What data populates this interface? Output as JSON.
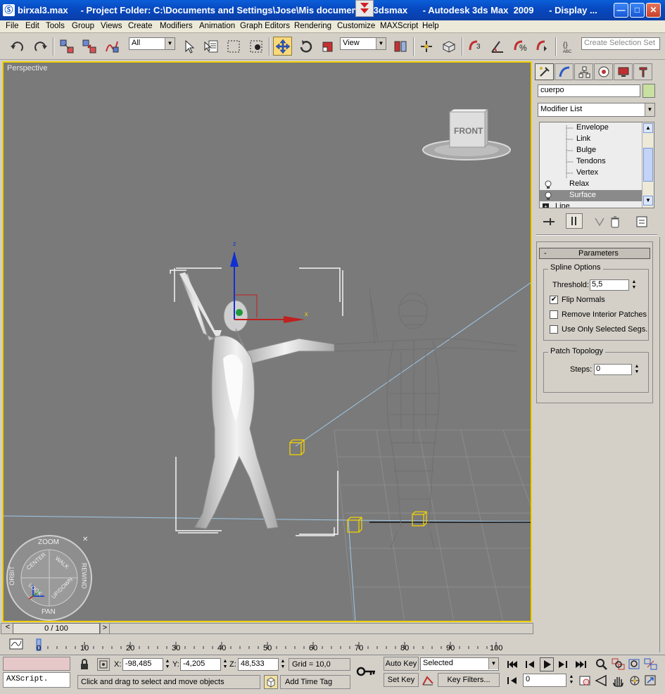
{
  "window": {
    "title": "birxal3.max     - Project Folder: C:\\Documents and Settings\\Jose\\Mis documentos\\3dsmax      - Autodesk 3ds Max  2009      - Display ...",
    "minimize_icon": "minimize-icon",
    "maximize_icon": "maximize-icon",
    "close_icon": "close-icon"
  },
  "menu": [
    "File",
    "Edit",
    "Tools",
    "Group",
    "Views",
    "Create",
    "Modifiers",
    "Animation",
    "Graph Editors",
    "Rendering",
    "Customize",
    "MAXScript",
    "Help"
  ],
  "toolbar": {
    "selection_filter": "All",
    "reference_coord": "View",
    "named_selection_placeholder": "Create Selection Set",
    "icons": [
      "undo-icon",
      "redo-icon",
      "select-link-icon",
      "unlink-icon",
      "bind-spacewarp-icon",
      "select-object-icon",
      "select-by-name-icon",
      "rectangle-region-icon",
      "window-crossing-icon",
      "select-move-icon",
      "select-rotate-icon",
      "select-scale-icon",
      "mirror-icon",
      "align-icon",
      "snap-3d-icon",
      "angle-snap-icon",
      "percent-snap-icon",
      "spinner-snap-icon",
      "named-selection-icon"
    ]
  },
  "viewport": {
    "label": "Perspective",
    "viewcube_face": "FRONT",
    "gizmo_z": "z",
    "gizmo_x": "x",
    "steering_wheel": {
      "zoom": "ZOOM",
      "orbit": "ORBIT",
      "rewind": "REWIND",
      "pan": "PAN",
      "center": "CENTER",
      "walk": "WALK",
      "look": "LOOK",
      "updown": "UP/DOWN"
    }
  },
  "command_panel": {
    "object_name": "cuerpo",
    "object_color": "#c8e0a0",
    "modifier_list_label": "Modifier List",
    "stack": [
      {
        "label": "Envelope",
        "indent": 2
      },
      {
        "label": "Link",
        "indent": 2
      },
      {
        "label": "Bulge",
        "indent": 2
      },
      {
        "label": "Tendons",
        "indent": 2
      },
      {
        "label": "Vertex",
        "indent": 2
      },
      {
        "label": "Relax",
        "indent": 1
      },
      {
        "label": "Surface",
        "indent": 1,
        "selected": true
      },
      {
        "label": "Line",
        "indent": 0
      }
    ],
    "rollout_title": "Parameters",
    "rollout_toggle": "-",
    "spline_options": {
      "group_label": "Spline Options",
      "threshold_label": "Threshold:",
      "threshold_value": "5,5",
      "flip_normals_label": "Flip Normals",
      "flip_normals_checked": true,
      "remove_interior_label": "Remove Interior Patches",
      "remove_interior_checked": false,
      "use_only_selected_label": "Use Only Selected Segs.",
      "use_only_selected_checked": false
    },
    "patch_topology": {
      "group_label": "Patch Topology",
      "steps_label": "Steps:",
      "steps_value": "0"
    }
  },
  "timeline": {
    "frame_counter": "0 / 100",
    "prev_arrow": "<",
    "next_arrow": ">",
    "ticks": [
      "0",
      "10",
      "20",
      "30",
      "40",
      "50",
      "60",
      "70",
      "80",
      "90",
      "100"
    ]
  },
  "status": {
    "maxscript_listener": "AXScript.",
    "x_label": "X:",
    "x_value": "-98,485",
    "y_label": "Y:",
    "y_value": "-4,205",
    "z_label": "Z:",
    "z_value": "48,533",
    "grid": "Grid = 10,0",
    "prompt": "Click and drag to select and move objects",
    "add_time_tag": "Add Time Tag",
    "auto_key": "Auto Key",
    "set_key": "Set Key",
    "key_mode": "Selected",
    "key_filters": "Key Filters...",
    "current_frame": "0"
  }
}
